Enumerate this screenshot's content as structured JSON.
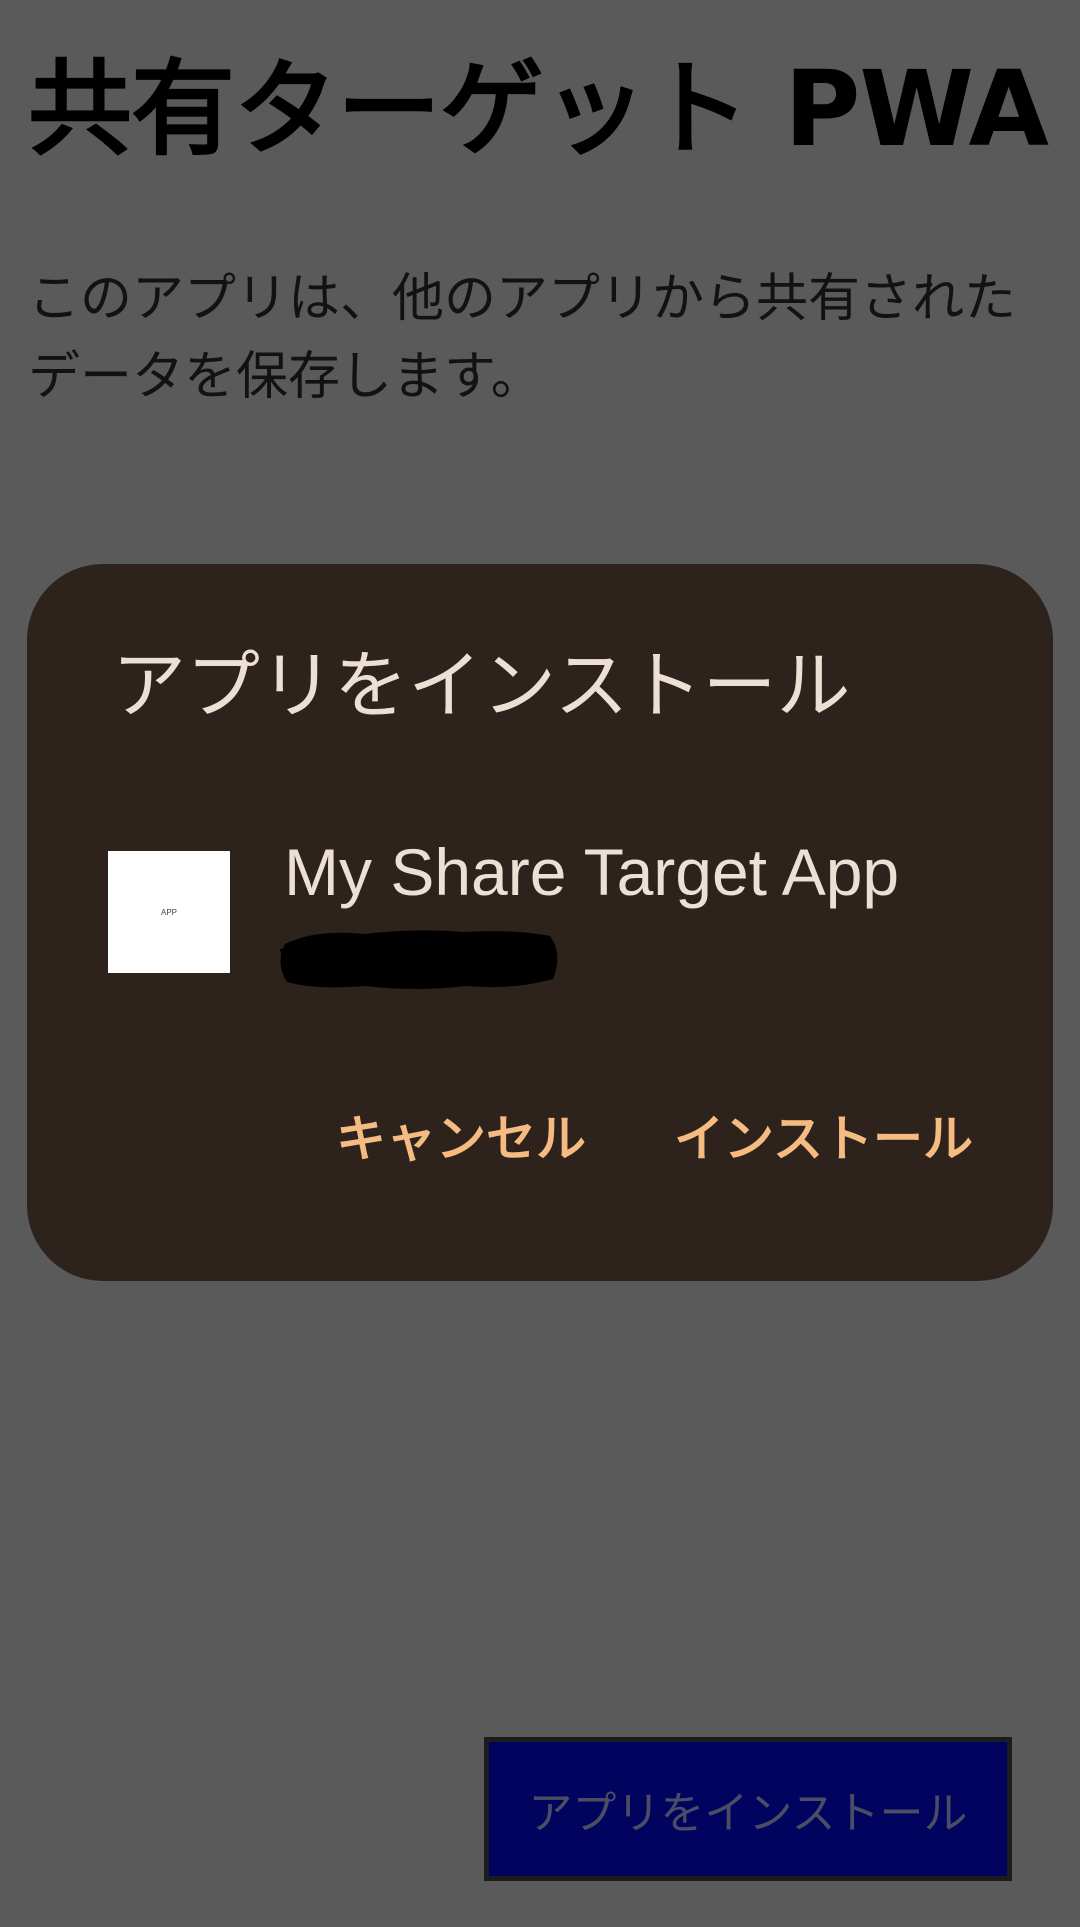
{
  "page": {
    "title": "共有ターゲット PWA",
    "description": "このアプリは、他のアプリから共有されたデータを保存します。",
    "install_button_label": "アプリをインストール"
  },
  "dialog": {
    "title": "アプリをインストール",
    "app_name": "My Share Target App",
    "app_icon_text": "APP",
    "cancel_label": "キャンセル",
    "install_label": "インストール"
  },
  "colors": {
    "scrim": "#5a5a5a",
    "dialog_background": "#2d231c",
    "dialog_text": "#ecdfd4",
    "dialog_accent": "#f5bb80",
    "page_button_background": "#00045e",
    "page_button_text": "#4b4d66"
  }
}
